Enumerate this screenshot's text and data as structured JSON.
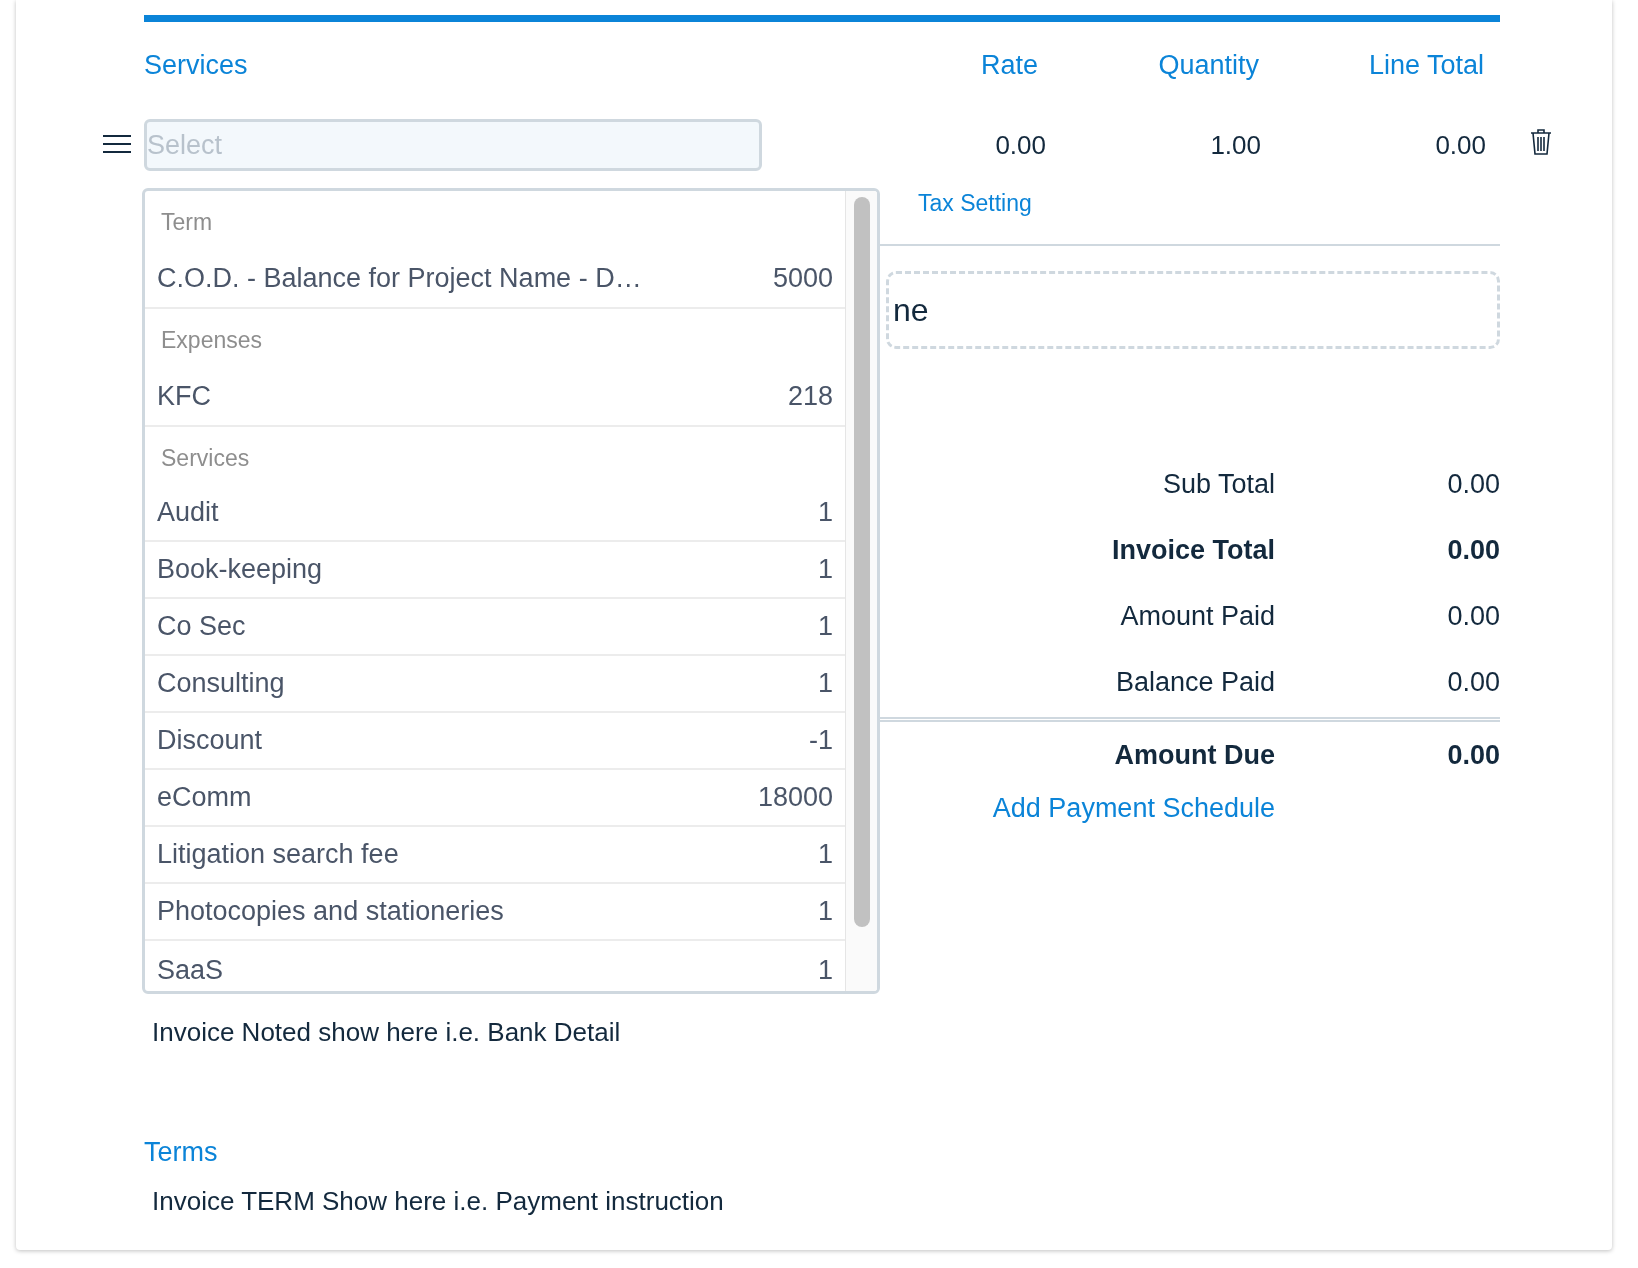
{
  "table": {
    "columns": [
      "Services",
      "Rate",
      "Quantity",
      "Line Total"
    ],
    "row": {
      "select_placeholder": "Select",
      "rate": "0.00",
      "quantity": "1.00",
      "line_total": "0.00",
      "tax_link": "Tax Setting"
    }
  },
  "dropdown": {
    "groups": [
      {
        "label": "Term",
        "options": [
          {
            "name": "C.O.D. - Balance for Project Name - D…",
            "value": "5000"
          }
        ]
      },
      {
        "label": "Expenses",
        "options": [
          {
            "name": "KFC",
            "value": "218"
          }
        ]
      },
      {
        "label": "Services",
        "options": [
          {
            "name": "Audit",
            "value": "1"
          },
          {
            "name": "Book-keeping",
            "value": "1"
          },
          {
            "name": "Co Sec",
            "value": "1"
          },
          {
            "name": "Consulting",
            "value": "1"
          },
          {
            "name": "Discount",
            "value": "-1"
          },
          {
            "name": "eComm",
            "value": "18000"
          },
          {
            "name": "Litigation search fee",
            "value": "1"
          },
          {
            "name": "Photocopies and stationeries",
            "value": "1"
          },
          {
            "name": "SaaS",
            "value": "1"
          }
        ]
      }
    ]
  },
  "add_line": {
    "text": "ne"
  },
  "totals": [
    {
      "label": "Sub Total",
      "value": "0.00",
      "bold": false
    },
    {
      "label": "Invoice Total",
      "value": "0.00",
      "bold": true
    },
    {
      "label": "Amount Paid",
      "value": "0.00",
      "bold": false
    },
    {
      "label": "Balance Paid",
      "value": "0.00",
      "bold": false
    }
  ],
  "amount_due": {
    "label": "Amount Due",
    "value": "0.00"
  },
  "payment_schedule_link": "Add Payment Schedule",
  "notes": {
    "text": "Invoice Noted show here i.e. Bank Detail"
  },
  "terms": {
    "title": "Terms",
    "text": "Invoice TERM Show here i.e. Payment instruction"
  }
}
